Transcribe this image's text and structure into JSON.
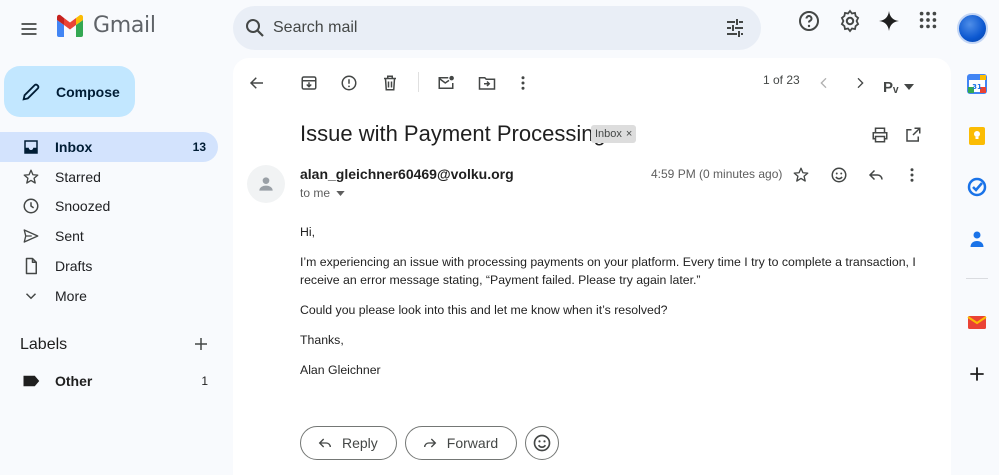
{
  "app": {
    "name": "Gmail"
  },
  "search": {
    "placeholder": "Search mail"
  },
  "compose": {
    "label": "Compose"
  },
  "nav": [
    {
      "label": "Inbox",
      "count": "13",
      "icon": "inbox-icon",
      "active": true
    },
    {
      "label": "Starred",
      "count": "",
      "icon": "star-icon"
    },
    {
      "label": "Snoozed",
      "count": "",
      "icon": "clock-icon"
    },
    {
      "label": "Sent",
      "count": "",
      "icon": "send-icon"
    },
    {
      "label": "Drafts",
      "count": "",
      "icon": "draft-icon"
    },
    {
      "label": "More",
      "count": "",
      "icon": "chevron-down-icon"
    }
  ],
  "labels": {
    "heading": "Labels",
    "items": [
      {
        "label": "Other",
        "count": "1"
      }
    ]
  },
  "toolbar": {
    "pager": "1 of 23",
    "input_tool": "Pᵥ"
  },
  "email": {
    "subject": "Issue with Payment Processing",
    "label_chip": "Inbox",
    "sender": "alan_gleichner60469@volku.org",
    "to": "to me",
    "time": "4:59 PM (0 minutes ago)",
    "body": [
      "Hi,",
      "I’m experiencing an issue with processing payments on your platform. Every time I try to complete a transaction, I receive an error message stating, “Payment failed. Please try again later.”",
      "Could you please look into this and let me know when it’s resolved?",
      "Thanks,",
      "Alan Gleichner"
    ]
  },
  "actions": {
    "reply": "Reply",
    "forward": "Forward"
  },
  "colors": {
    "accent": "#0b57d0",
    "compose_bg": "#c2e7ff",
    "active_nav": "#d3e3fd",
    "panel_bg": "#ffffff",
    "app_bg": "#f8fafd"
  }
}
